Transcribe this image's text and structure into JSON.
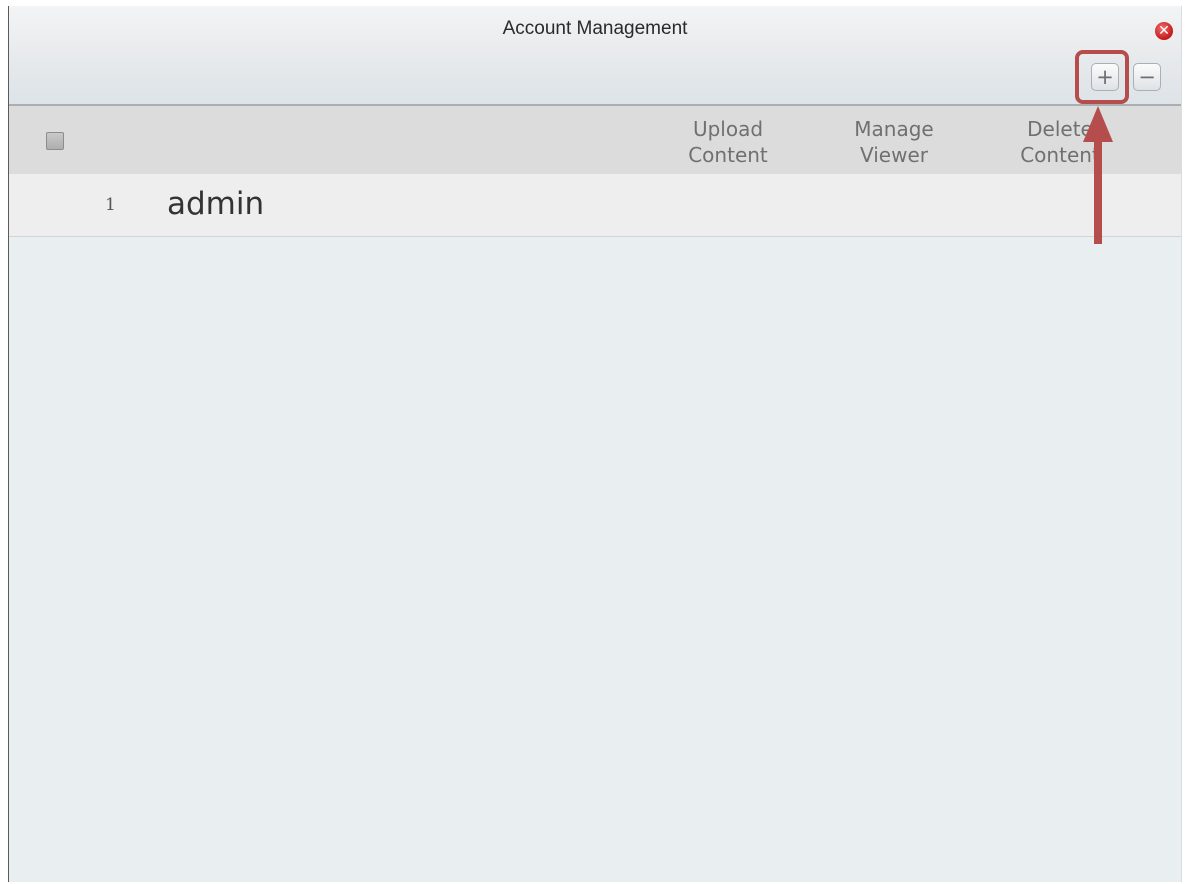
{
  "window": {
    "title": "Account Management",
    "close_icon": "close-icon",
    "close_color": "#cc2020"
  },
  "toolbar": {
    "add_label": "+",
    "add_icon": "plus-icon",
    "remove_label": "−",
    "remove_icon": "minus-icon"
  },
  "table": {
    "columns": [
      "Upload\nContent",
      "Manage\nViewer",
      "Delete\nContent"
    ],
    "rows": [
      {
        "number": "1",
        "name": "admin"
      }
    ]
  },
  "annotation": {
    "highlight_color": "#b64d4d",
    "arrow_direction": "up"
  }
}
